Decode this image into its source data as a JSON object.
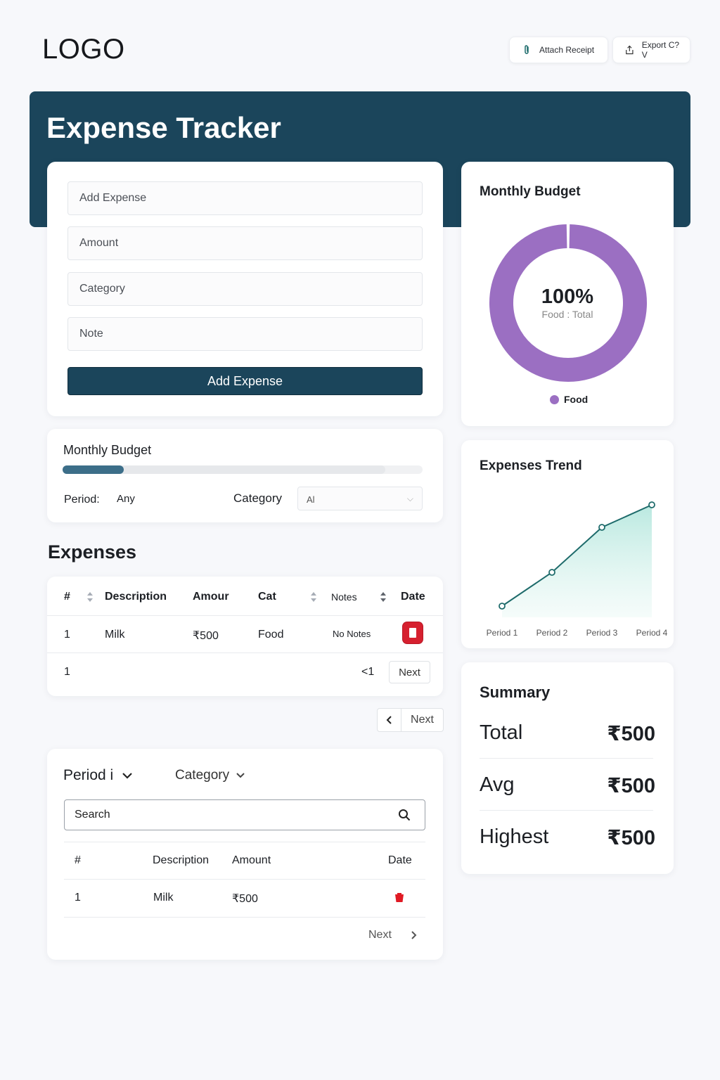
{
  "logo": "LOGO",
  "toolbar": {
    "attach_label": "Attach Receipt",
    "export_label": "Export C?V"
  },
  "header": {
    "title": "Expense Tracker"
  },
  "form": {
    "placeholders": {
      "add_expense": "Add Expense",
      "amount": "Amount",
      "category": "Category",
      "note": "Note"
    },
    "submit_label": "Add Expense"
  },
  "budget_filter": {
    "title": "Monthly Budget",
    "progress_fraction": 0.17,
    "period_label": "Period:",
    "period_value": "Any",
    "category_label": "Category",
    "category_value": "Al"
  },
  "expenses": {
    "title": "Expenses",
    "columns": [
      "#",
      "Description",
      "Amour",
      "Cat",
      "Notes",
      "Date"
    ],
    "rows": [
      {
        "num": "1",
        "description": "Milk",
        "amount": "₹500",
        "category": "Food",
        "notes": "No Notes"
      }
    ],
    "footer_count": "1",
    "pager_prev": "<1",
    "pager_next": "Next"
  },
  "outer_pager": {
    "next": "Next"
  },
  "filtered": {
    "period_label": "Period i",
    "category_label": "Category",
    "search_placeholder": "Search",
    "columns": [
      "#",
      "Description",
      "Amount",
      "Date"
    ],
    "rows": [
      {
        "num": "1",
        "description": "Milk",
        "amount": "₹500"
      }
    ],
    "next_label": "Next"
  },
  "donut": {
    "title": "Monthly Budget",
    "center_value": "100%",
    "center_label": "Food : Total",
    "legend_label": "Food",
    "color": "#9b6fc2"
  },
  "trend": {
    "title": "Expenses Trend"
  },
  "summary": {
    "title": "Summary",
    "rows": [
      {
        "label": "Total",
        "value": "₹500"
      },
      {
        "label": "Avg",
        "value": "₹500"
      },
      {
        "label": "Highest",
        "value": "₹500"
      }
    ]
  },
  "chart_data": [
    {
      "type": "pie",
      "title": "Monthly Budget",
      "categories": [
        "Food"
      ],
      "values": [
        100
      ],
      "colors": [
        "#9b6fc2"
      ]
    },
    {
      "type": "area",
      "title": "Expenses Trend",
      "categories": [
        "Period 1",
        "Period 2",
        "Period 3",
        "Period 4"
      ],
      "values": [
        1,
        4,
        8,
        10
      ],
      "ylim": [
        0,
        12
      ],
      "grid": false,
      "color": "#1e6b6b"
    }
  ]
}
